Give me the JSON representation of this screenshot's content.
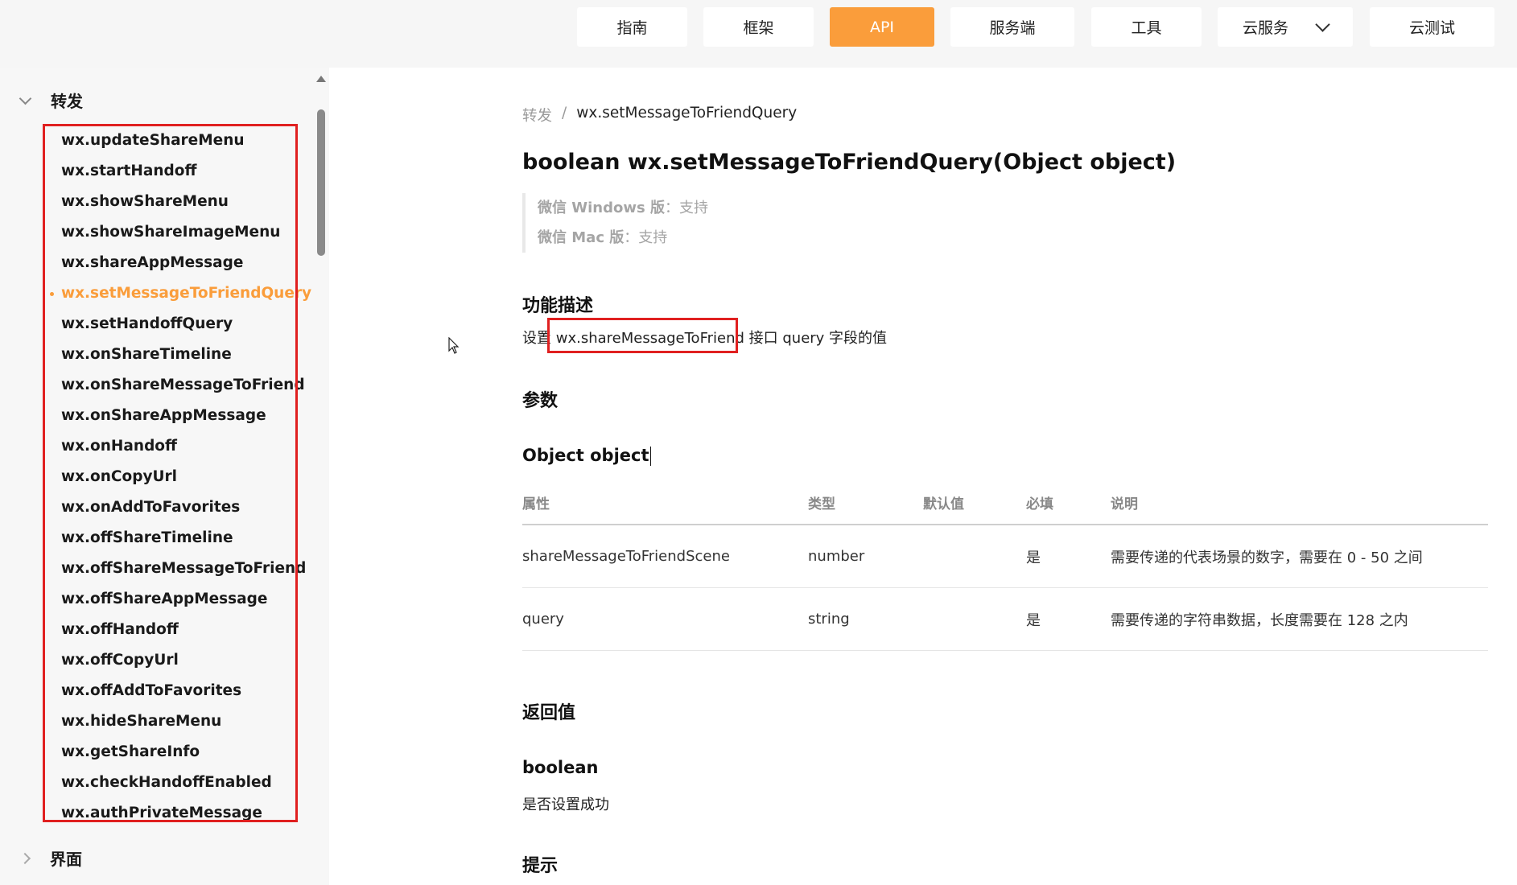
{
  "topnav": {
    "items": [
      {
        "label": "指南"
      },
      {
        "label": "框架"
      },
      {
        "label": "API",
        "active": true
      },
      {
        "label": "服务端"
      },
      {
        "label": "工具"
      },
      {
        "label": "云服务",
        "has_dropdown": true
      },
      {
        "label": "云测试"
      }
    ],
    "active_color": "#fa9d3b"
  },
  "sidebar": {
    "group_forward": "转发",
    "items": [
      "wx.updateShareMenu",
      "wx.startHandoff",
      "wx.showShareMenu",
      "wx.showShareImageMenu",
      "wx.shareAppMessage",
      "wx.setMessageToFriendQuery",
      "wx.setHandoffQuery",
      "wx.onShareTimeline",
      "wx.onShareMessageToFriend",
      "wx.onShareAppMessage",
      "wx.onHandoff",
      "wx.onCopyUrl",
      "wx.onAddToFavorites",
      "wx.offShareTimeline",
      "wx.offShareMessageToFriend",
      "wx.offShareAppMessage",
      "wx.offHandoff",
      "wx.offCopyUrl",
      "wx.offAddToFavorites",
      "wx.hideShareMenu",
      "wx.getShareInfo",
      "wx.checkHandoffEnabled",
      "wx.authPrivateMessage"
    ],
    "current_index": 5,
    "group_ui": "界面"
  },
  "breadcrumb": {
    "root": "转发",
    "separator": "/",
    "current": "wx.setMessageToFriendQuery"
  },
  "title": "boolean wx.setMessageToFriendQuery(Object object)",
  "support": {
    "windows_label": "微信 Windows 版",
    "windows_value": "：支持",
    "mac_label": "微信 Mac 版",
    "mac_value": "：支持"
  },
  "description": {
    "heading": "功能描述",
    "prefix": "设置 ",
    "api": "wx.shareMessageToFriend",
    "suffix": " 接口 query 字段的值"
  },
  "params": {
    "heading": "参数",
    "object_heading": "Object object",
    "columns": [
      "属性",
      "类型",
      "默认值",
      "必填",
      "说明"
    ],
    "rows": [
      {
        "name": "shareMessageToFriendScene",
        "type": "number",
        "default": "",
        "required": "是",
        "desc": "需要传递的代表场景的数字，需要在 0 - 50 之间"
      },
      {
        "name": "query",
        "type": "string",
        "default": "",
        "required": "是",
        "desc": "需要传递的字符串数据，长度需要在 128 之内"
      }
    ]
  },
  "return_value": {
    "heading": "返回值",
    "type": "boolean",
    "desc": "是否设置成功"
  },
  "tips_heading": "提示"
}
